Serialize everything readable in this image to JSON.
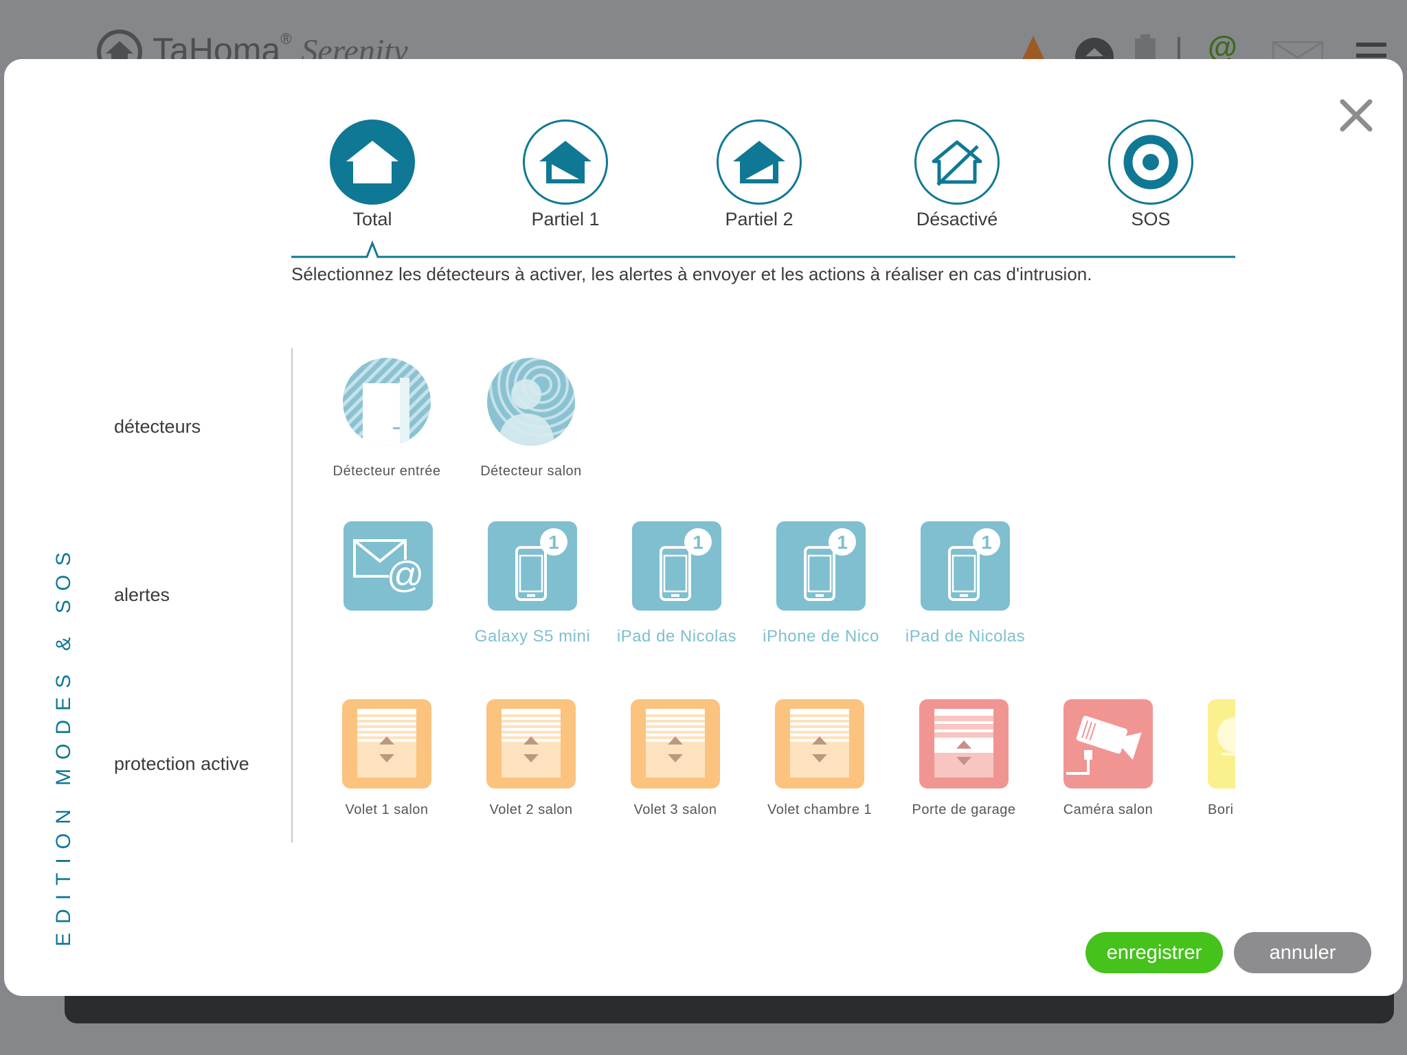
{
  "background": {
    "brand_name": "TaHoma",
    "brand_reg": "®",
    "brand_sub": "Serenity"
  },
  "modal": {
    "vertical_title": "EDITION MODES & SOS",
    "intro": "Sélectionnez les détecteurs à activer, les alertes à envoyer et les actions à réaliser en cas d'intrusion.",
    "modes": [
      {
        "label": "Total",
        "icon": "house-full-icon",
        "active": true
      },
      {
        "label": "Partiel 1",
        "icon": "house-partial-icon",
        "active": false
      },
      {
        "label": "Partiel 2",
        "icon": "house-partial-icon",
        "active": false
      },
      {
        "label": "Désactivé",
        "icon": "house-disabled-icon",
        "active": false
      },
      {
        "label": "SOS",
        "icon": "target-icon",
        "active": false
      }
    ],
    "rows": {
      "detectors_label": "détecteurs",
      "alerts_label": "alertes",
      "protection_label": "protection active"
    },
    "detectors": [
      {
        "label": "Détecteur entrée",
        "icon": "door-sensor-icon"
      },
      {
        "label": "Détecteur salon",
        "icon": "motion-sensor-icon"
      }
    ],
    "alerts": [
      {
        "label": "",
        "icon": "email-alert-icon"
      },
      {
        "label": "Galaxy S5 mini",
        "icon": "phone-notification-icon",
        "badge": "1"
      },
      {
        "label": "iPad de Nicolas",
        "icon": "phone-notification-icon",
        "badge": "1"
      },
      {
        "label": "iPhone de Nico",
        "icon": "phone-notification-icon",
        "badge": "1"
      },
      {
        "label": "iPad de Nicolas",
        "icon": "phone-notification-icon",
        "badge": "1"
      }
    ],
    "protection": [
      {
        "label": "Volet 1 salon",
        "icon": "roller-shutter-icon"
      },
      {
        "label": "Volet 2 salon",
        "icon": "roller-shutter-icon"
      },
      {
        "label": "Volet 3 salon",
        "icon": "roller-shutter-icon"
      },
      {
        "label": "Volet chambre 1",
        "icon": "roller-shutter-icon"
      },
      {
        "label": "Porte de garage",
        "icon": "garage-door-icon"
      },
      {
        "label": "Caméra salon",
        "icon": "camera-icon"
      },
      {
        "label": "Bori",
        "icon": "light-icon"
      }
    ],
    "buttons": {
      "save": "enregistrer",
      "cancel": "annuler"
    },
    "colors": {
      "accent": "#0f7894",
      "alert_tile": "#7fbfcf",
      "shutter_tile": "#fbc37e",
      "garage_tile": "#f09592",
      "light_tile": "#fbf08e",
      "save": "#46c21d",
      "cancel": "#8d8d8f"
    }
  }
}
